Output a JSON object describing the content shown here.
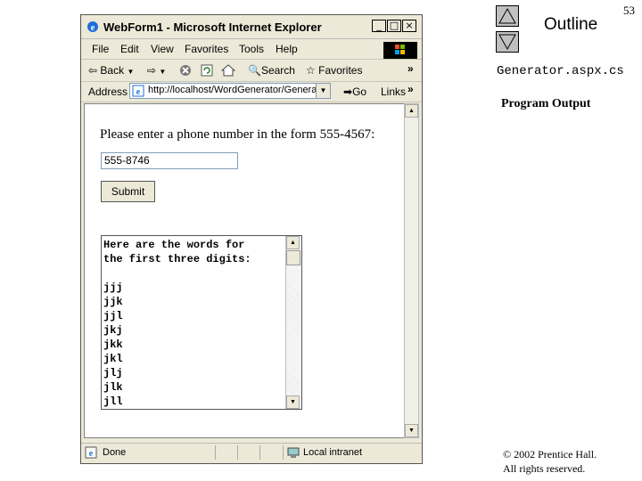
{
  "slide": {
    "outline_label": "Outline",
    "page_number": "53",
    "title": "Generator.aspx.cs",
    "subtitle": "Program Output",
    "copyright_line1": "© 2002 Prentice Hall.",
    "copyright_line2": "All rights reserved."
  },
  "window": {
    "title": "WebForm1 - Microsoft Internet Explorer",
    "controls": [
      "_",
      "□",
      "×"
    ]
  },
  "menu": [
    "File",
    "Edit",
    "View",
    "Favorites",
    "Tools",
    "Help"
  ],
  "toolbar": {
    "back": "Back",
    "search": "Search",
    "favorites": "Favorites"
  },
  "address": {
    "label": "Address",
    "url": "http://localhost/WordGenerator/Generator.aspx",
    "go": "Go",
    "links": "Links"
  },
  "page": {
    "prompt": "Please enter a phone number in the form 555-4567:",
    "phone_value": "555-8746",
    "submit_label": "Submit",
    "output": "Here are the words for\nthe first three digits:\n\njjj\njjk\njjl\njkj\njkk\njkl\njlj\njlk\njll"
  },
  "status": {
    "text": "Done",
    "zone": "Local intranet"
  }
}
